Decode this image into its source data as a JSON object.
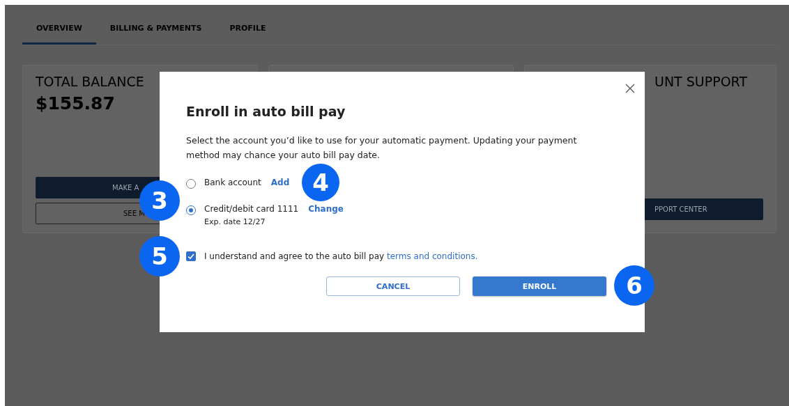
{
  "tabs": [
    {
      "label": "OVERVIEW",
      "selected": true
    },
    {
      "label": "BILLING & PAYMENTS",
      "selected": false
    },
    {
      "label": "PROFILE",
      "selected": false
    }
  ],
  "balance_card": {
    "title": "TOTAL BALANCE",
    "amount": "$155.87",
    "primary_button": "MAKE A",
    "secondary_button": "SEE M"
  },
  "support_card": {
    "title": "UNT SUPPORT",
    "button": "PPORT CENTER"
  },
  "dialog": {
    "title": "Enroll in auto bill pay",
    "description": "Select the account you’d like to use for your automatic payment. Updating your payment method may chance your auto bill pay date.",
    "options": [
      {
        "label": "Bank account",
        "link": "Add",
        "selected": false,
        "link_callout": "4"
      },
      {
        "label": "Credit/debit card 1111",
        "detail": "Exp. date 12/27",
        "link": "Change",
        "selected": true
      }
    ],
    "options_callout": "3",
    "agreement": {
      "text": "I understand and agree to the auto bill pay",
      "link": "terms and conditions.",
      "checked": true,
      "callout": "5"
    },
    "buttons": [
      {
        "label": "CANCEL",
        "kind": "secondary"
      },
      {
        "label": "ENROLL",
        "kind": "primary",
        "callout": "6"
      }
    ]
  }
}
